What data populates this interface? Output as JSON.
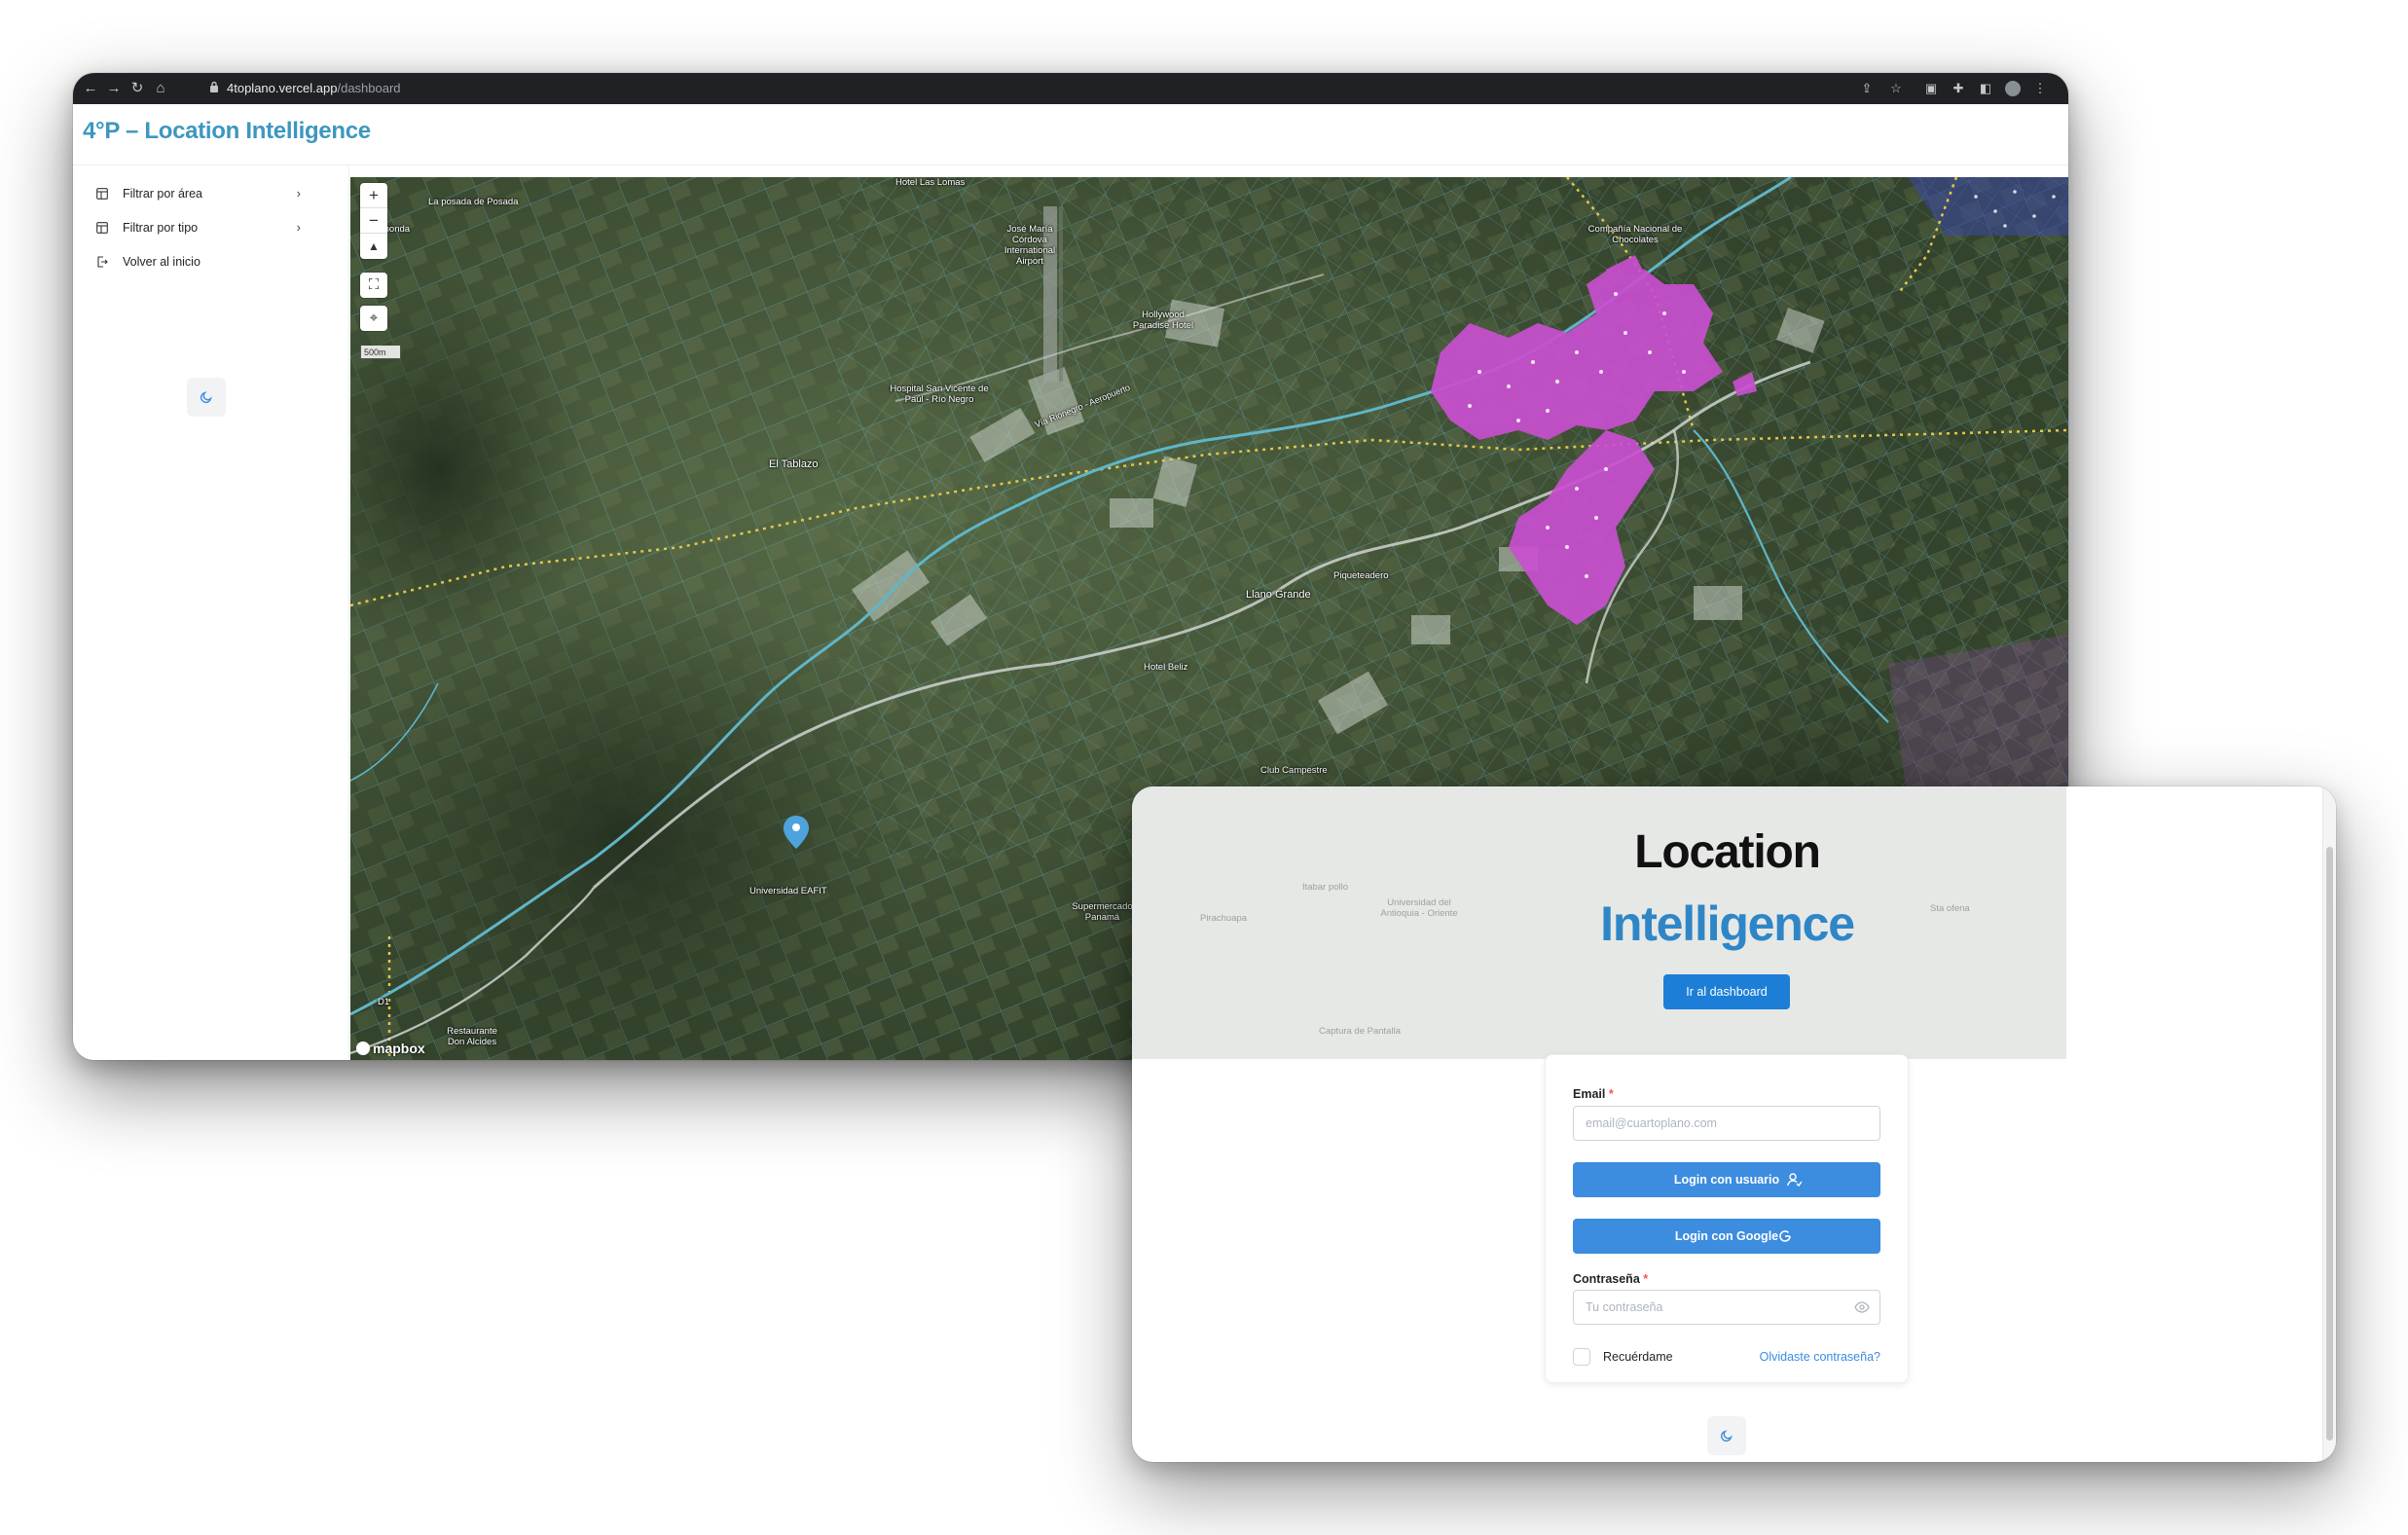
{
  "browser": {
    "url_host": "4toplano.vercel.app",
    "url_path": "/dashboard"
  },
  "app": {
    "title": "4°P – Location Intelligence"
  },
  "sidebar": {
    "items": [
      {
        "label": "Filtrar por área",
        "icon": "filter-layout-icon",
        "has_chevron": true
      },
      {
        "label": "Filtrar por tipo",
        "icon": "filter-layout-icon",
        "has_chevron": true
      },
      {
        "label": "Volver al inicio",
        "icon": "logout-icon",
        "has_chevron": false
      }
    ],
    "theme_icon": "moon-icon"
  },
  "map": {
    "scale": "500m",
    "attribution": "mapbox",
    "labels": {
      "l01": "Hotel Las Lomas",
      "l02": "La posada de Posada",
      "l03": "monda",
      "l04": "José María Córdova International Airport",
      "l05": "Hollywood Paradise Hotel",
      "l06": "Compañía Nacional de Chocolates",
      "l07": "Hospital San Vicente de Paúl - Río Negro",
      "l08": "El Tablazo",
      "l09": "Vía Rionegro - Aeropuerto",
      "l10": "Llano Grande",
      "l11": "Piqueteadero",
      "l12": "Hotel Beliz",
      "l13": "Club Campestre",
      "l14": "Universidad EAFIT",
      "l15": "Supermercado Panamá",
      "l16": "Restaurante Don Alcides",
      "l17": "D1"
    },
    "colors": {
      "clusters": "#c94fd0",
      "roads": "#cfd4d0",
      "water": "#5fb6c9",
      "boundary": "#e3c84a",
      "marker": "#4ea3dd"
    }
  },
  "login": {
    "hero_line1": "Location",
    "hero_line2": "Intelligence",
    "dashboard_button": "Ir al dashboard",
    "ghost_labels": {
      "g1": "Captura de Pantalla",
      "g2": "Itabar pollo",
      "g3": "Pirachuapa",
      "g4": "Universidad del Antioquia - Oriente",
      "g5": "Sta ofena"
    },
    "email_label": "Email",
    "email_required": "*",
    "email_placeholder": "email@cuartoplano.com",
    "login_user_button": "Login con usuario",
    "login_google_button": "Login con Google",
    "password_label": "Contraseña",
    "password_required": "*",
    "password_placeholder": "Tu contraseña",
    "remember_label": "Recuérdame",
    "forgot_link": "Olvidaste contraseña?",
    "theme_icon": "moon-icon"
  }
}
